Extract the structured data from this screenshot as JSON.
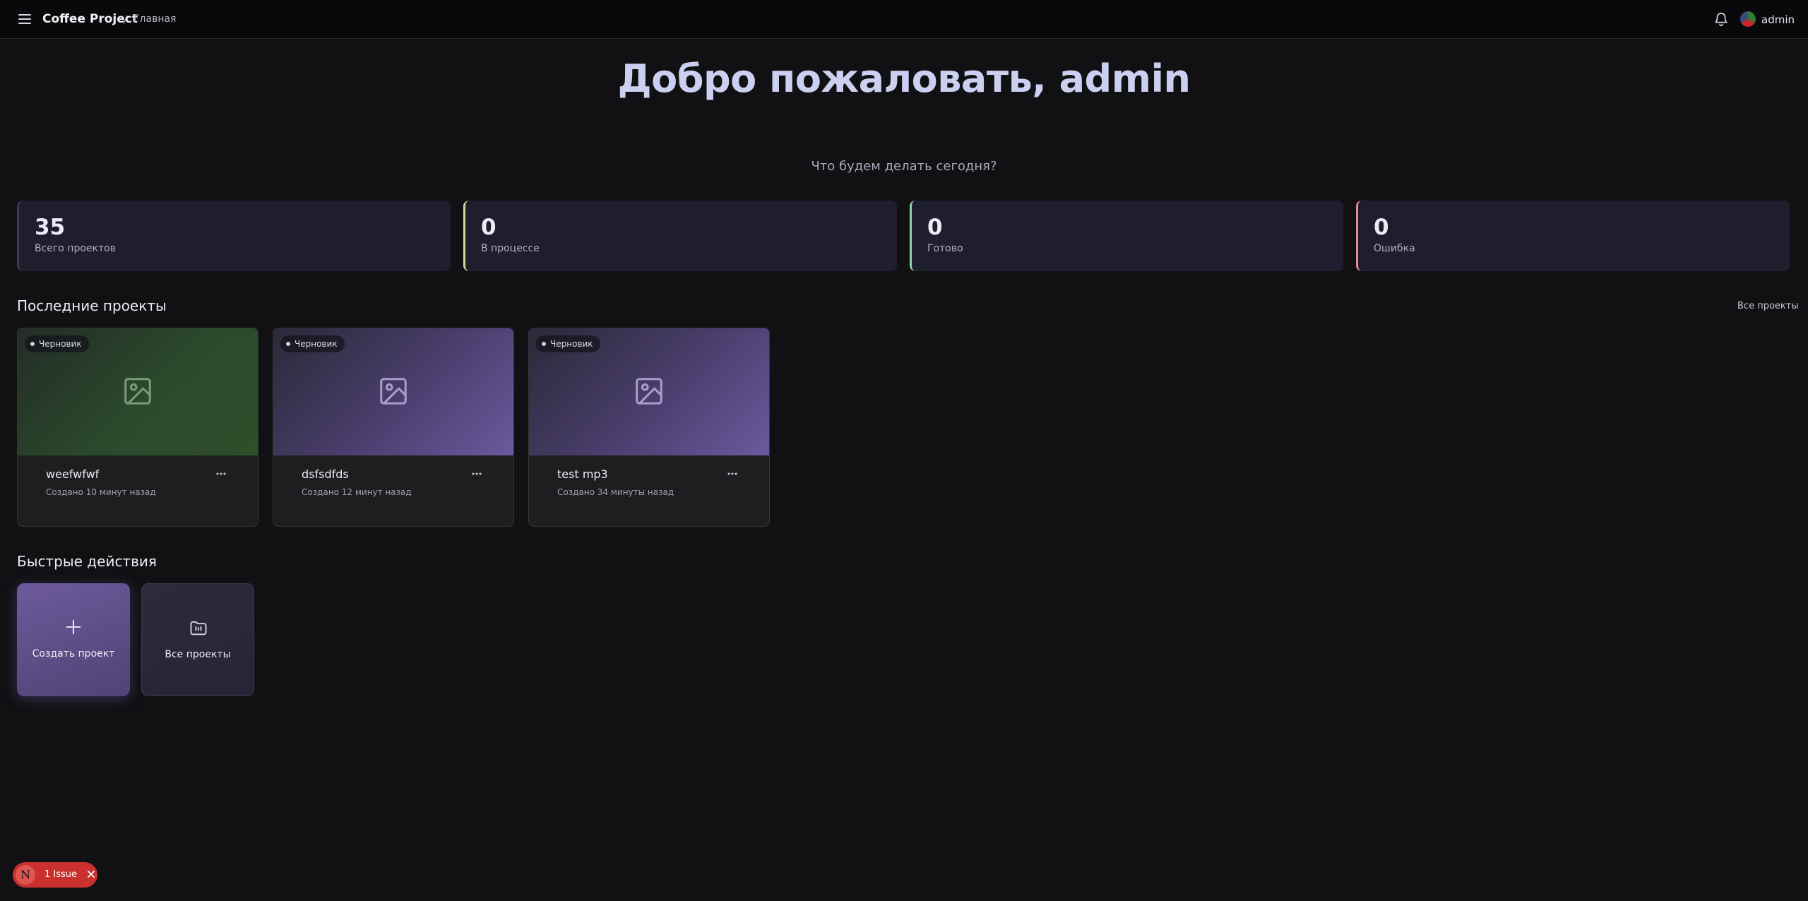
{
  "header": {
    "brand": "Coffee Project",
    "separator": "/",
    "breadcrumb": "Главная",
    "user_name": "admin",
    "icons": {
      "menu": "hamburger-menu-icon",
      "notifications": "bell-icon"
    }
  },
  "hero": {
    "title": "Добро пожаловать, admin",
    "subtitle": "Что будем делать сегодня?"
  },
  "stats": [
    {
      "value": "35",
      "label": "Всего проектов",
      "accent": "#3c3c52"
    },
    {
      "value": "0",
      "label": "В процессе",
      "accent": "#d9d49a"
    },
    {
      "value": "0",
      "label": "Готово",
      "accent": "#8fd4a2"
    },
    {
      "value": "0",
      "label": "Ошибка",
      "accent": "#e58a94"
    }
  ],
  "recent": {
    "title": "Последние проекты",
    "all_link": "Все проекты",
    "projects": [
      {
        "name": "weefwfwf",
        "status": "Черновик",
        "created": "Создано 10 минут назад"
      },
      {
        "name": "dsfsdfds",
        "status": "Черновик",
        "created": "Создано 12 минут назад"
      },
      {
        "name": "test mp3",
        "status": "Черновик",
        "created": "Создано 34 минуты назад"
      }
    ]
  },
  "quick_actions": {
    "title": "Быстрые действия",
    "items": [
      {
        "label": "Создать проект",
        "icon": "plus-icon"
      },
      {
        "label": "Все проекты",
        "icon": "folder-icon"
      }
    ]
  },
  "issue_badge": {
    "letter": "N",
    "text": "1 Issue",
    "color": "#c9302e"
  }
}
